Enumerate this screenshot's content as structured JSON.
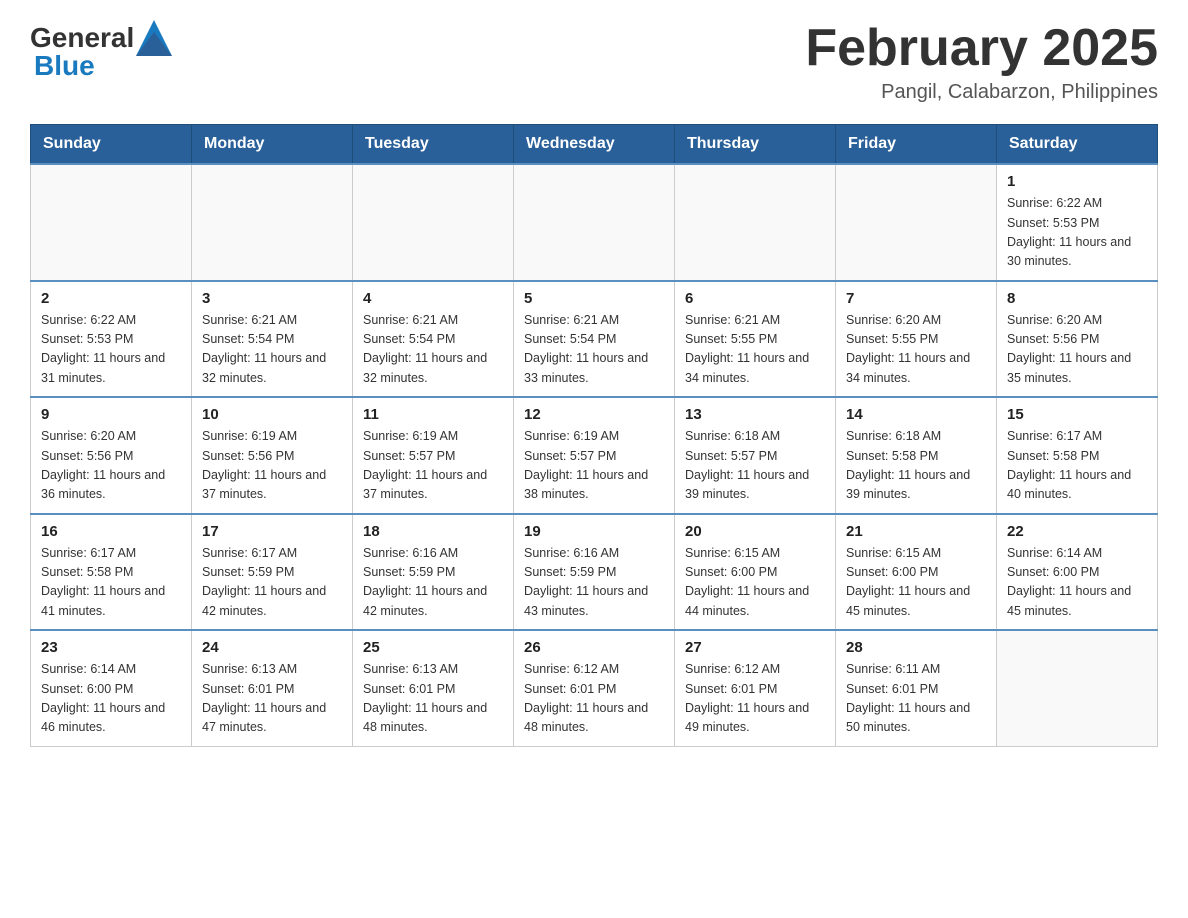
{
  "header": {
    "logo_general": "General",
    "logo_blue": "Blue",
    "main_title": "February 2025",
    "subtitle": "Pangil, Calabarzon, Philippines"
  },
  "calendar": {
    "days_of_week": [
      "Sunday",
      "Monday",
      "Tuesday",
      "Wednesday",
      "Thursday",
      "Friday",
      "Saturday"
    ],
    "weeks": [
      [
        {
          "day": "",
          "info": ""
        },
        {
          "day": "",
          "info": ""
        },
        {
          "day": "",
          "info": ""
        },
        {
          "day": "",
          "info": ""
        },
        {
          "day": "",
          "info": ""
        },
        {
          "day": "",
          "info": ""
        },
        {
          "day": "1",
          "info": "Sunrise: 6:22 AM\nSunset: 5:53 PM\nDaylight: 11 hours and 30 minutes."
        }
      ],
      [
        {
          "day": "2",
          "info": "Sunrise: 6:22 AM\nSunset: 5:53 PM\nDaylight: 11 hours and 31 minutes."
        },
        {
          "day": "3",
          "info": "Sunrise: 6:21 AM\nSunset: 5:54 PM\nDaylight: 11 hours and 32 minutes."
        },
        {
          "day": "4",
          "info": "Sunrise: 6:21 AM\nSunset: 5:54 PM\nDaylight: 11 hours and 32 minutes."
        },
        {
          "day": "5",
          "info": "Sunrise: 6:21 AM\nSunset: 5:54 PM\nDaylight: 11 hours and 33 minutes."
        },
        {
          "day": "6",
          "info": "Sunrise: 6:21 AM\nSunset: 5:55 PM\nDaylight: 11 hours and 34 minutes."
        },
        {
          "day": "7",
          "info": "Sunrise: 6:20 AM\nSunset: 5:55 PM\nDaylight: 11 hours and 34 minutes."
        },
        {
          "day": "8",
          "info": "Sunrise: 6:20 AM\nSunset: 5:56 PM\nDaylight: 11 hours and 35 minutes."
        }
      ],
      [
        {
          "day": "9",
          "info": "Sunrise: 6:20 AM\nSunset: 5:56 PM\nDaylight: 11 hours and 36 minutes."
        },
        {
          "day": "10",
          "info": "Sunrise: 6:19 AM\nSunset: 5:56 PM\nDaylight: 11 hours and 37 minutes."
        },
        {
          "day": "11",
          "info": "Sunrise: 6:19 AM\nSunset: 5:57 PM\nDaylight: 11 hours and 37 minutes."
        },
        {
          "day": "12",
          "info": "Sunrise: 6:19 AM\nSunset: 5:57 PM\nDaylight: 11 hours and 38 minutes."
        },
        {
          "day": "13",
          "info": "Sunrise: 6:18 AM\nSunset: 5:57 PM\nDaylight: 11 hours and 39 minutes."
        },
        {
          "day": "14",
          "info": "Sunrise: 6:18 AM\nSunset: 5:58 PM\nDaylight: 11 hours and 39 minutes."
        },
        {
          "day": "15",
          "info": "Sunrise: 6:17 AM\nSunset: 5:58 PM\nDaylight: 11 hours and 40 minutes."
        }
      ],
      [
        {
          "day": "16",
          "info": "Sunrise: 6:17 AM\nSunset: 5:58 PM\nDaylight: 11 hours and 41 minutes."
        },
        {
          "day": "17",
          "info": "Sunrise: 6:17 AM\nSunset: 5:59 PM\nDaylight: 11 hours and 42 minutes."
        },
        {
          "day": "18",
          "info": "Sunrise: 6:16 AM\nSunset: 5:59 PM\nDaylight: 11 hours and 42 minutes."
        },
        {
          "day": "19",
          "info": "Sunrise: 6:16 AM\nSunset: 5:59 PM\nDaylight: 11 hours and 43 minutes."
        },
        {
          "day": "20",
          "info": "Sunrise: 6:15 AM\nSunset: 6:00 PM\nDaylight: 11 hours and 44 minutes."
        },
        {
          "day": "21",
          "info": "Sunrise: 6:15 AM\nSunset: 6:00 PM\nDaylight: 11 hours and 45 minutes."
        },
        {
          "day": "22",
          "info": "Sunrise: 6:14 AM\nSunset: 6:00 PM\nDaylight: 11 hours and 45 minutes."
        }
      ],
      [
        {
          "day": "23",
          "info": "Sunrise: 6:14 AM\nSunset: 6:00 PM\nDaylight: 11 hours and 46 minutes."
        },
        {
          "day": "24",
          "info": "Sunrise: 6:13 AM\nSunset: 6:01 PM\nDaylight: 11 hours and 47 minutes."
        },
        {
          "day": "25",
          "info": "Sunrise: 6:13 AM\nSunset: 6:01 PM\nDaylight: 11 hours and 48 minutes."
        },
        {
          "day": "26",
          "info": "Sunrise: 6:12 AM\nSunset: 6:01 PM\nDaylight: 11 hours and 48 minutes."
        },
        {
          "day": "27",
          "info": "Sunrise: 6:12 AM\nSunset: 6:01 PM\nDaylight: 11 hours and 49 minutes."
        },
        {
          "day": "28",
          "info": "Sunrise: 6:11 AM\nSunset: 6:01 PM\nDaylight: 11 hours and 50 minutes."
        },
        {
          "day": "",
          "info": ""
        }
      ]
    ]
  }
}
